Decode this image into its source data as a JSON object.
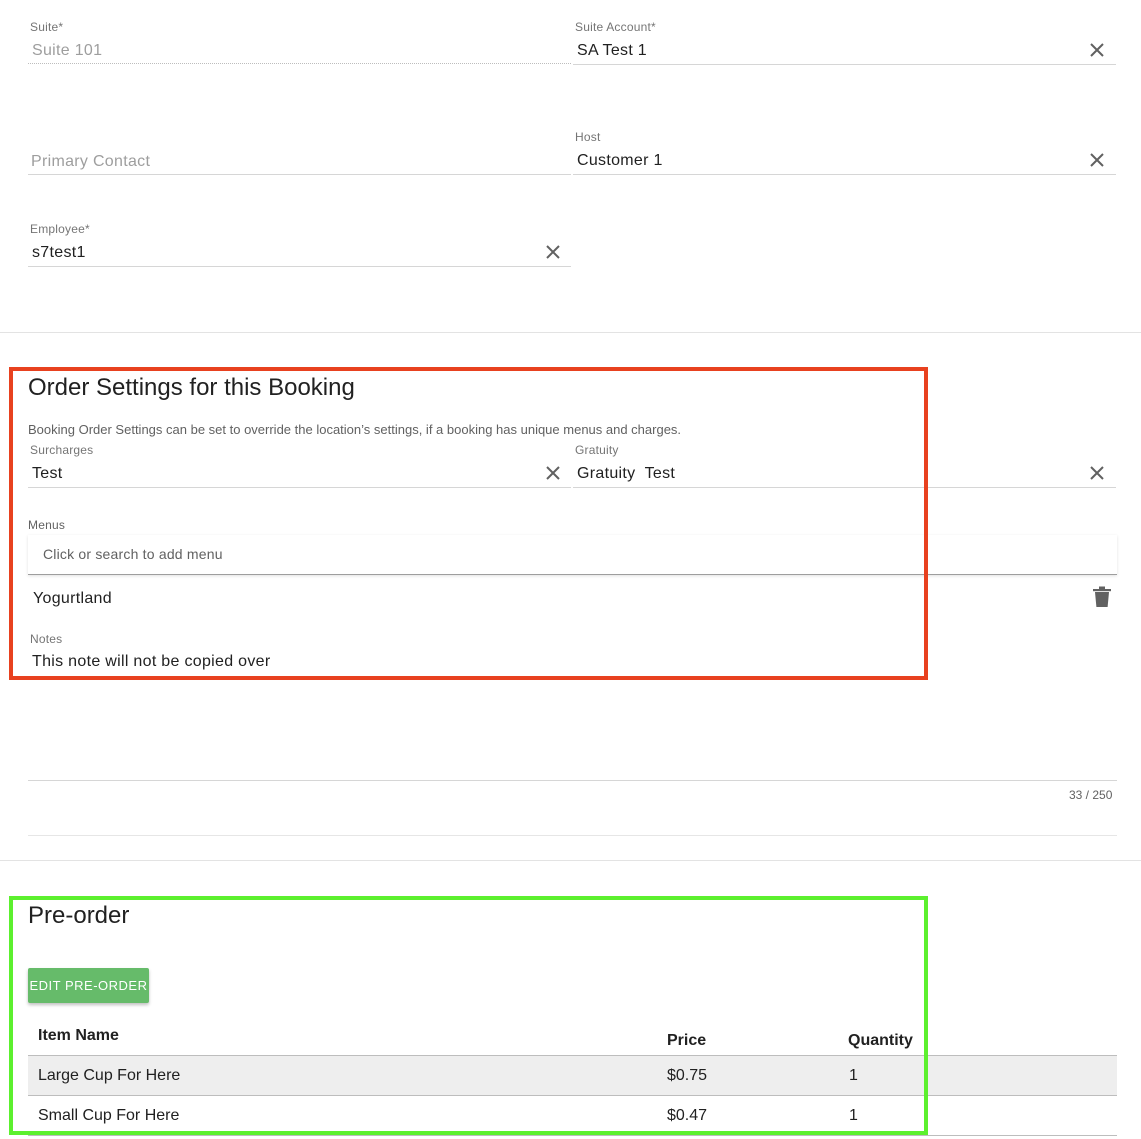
{
  "booking": {
    "suite": {
      "label": "Suite",
      "required": "*",
      "value": "Suite 101"
    },
    "suite_account": {
      "label": "Suite Account",
      "required": "*",
      "value": "SA Test 1"
    },
    "primary_contact": {
      "placeholder": "Primary Contact"
    },
    "host": {
      "label": "Host",
      "value": "Customer 1"
    },
    "employee": {
      "label": "Employee",
      "required": "*",
      "value": "s7test1"
    }
  },
  "order_settings": {
    "title": "Order Settings for this Booking",
    "description": "Booking Order Settings can be set to override the location’s settings, if a booking has unique menus and charges.",
    "surcharges": {
      "label": "Surcharges",
      "value": "Test"
    },
    "gratuity": {
      "label": "Gratuity",
      "value": "Gratuity  Test"
    },
    "menus": {
      "label": "Menus",
      "placeholder": "Click or search to add menu",
      "items": [
        "Yogurtland"
      ]
    },
    "notes": {
      "label": "Notes",
      "value": "This note will not be copied over",
      "counter": "33 / 250"
    }
  },
  "pre_order": {
    "title": "Pre-order",
    "edit_button": "EDIT PRE-ORDER",
    "columns": [
      "Item Name",
      "Price",
      "Quantity"
    ],
    "rows": [
      {
        "name": "Large Cup For Here",
        "price": "$0.75",
        "quantity": "1"
      },
      {
        "name": "Small Cup For Here",
        "price": "$0.47",
        "quantity": "1"
      }
    ]
  },
  "annotations": {
    "order_settings_box_color": "#e8411f",
    "pre_order_box_color": "#5cf02e"
  },
  "icons": {
    "clear": "close-icon",
    "delete": "trash-icon"
  }
}
